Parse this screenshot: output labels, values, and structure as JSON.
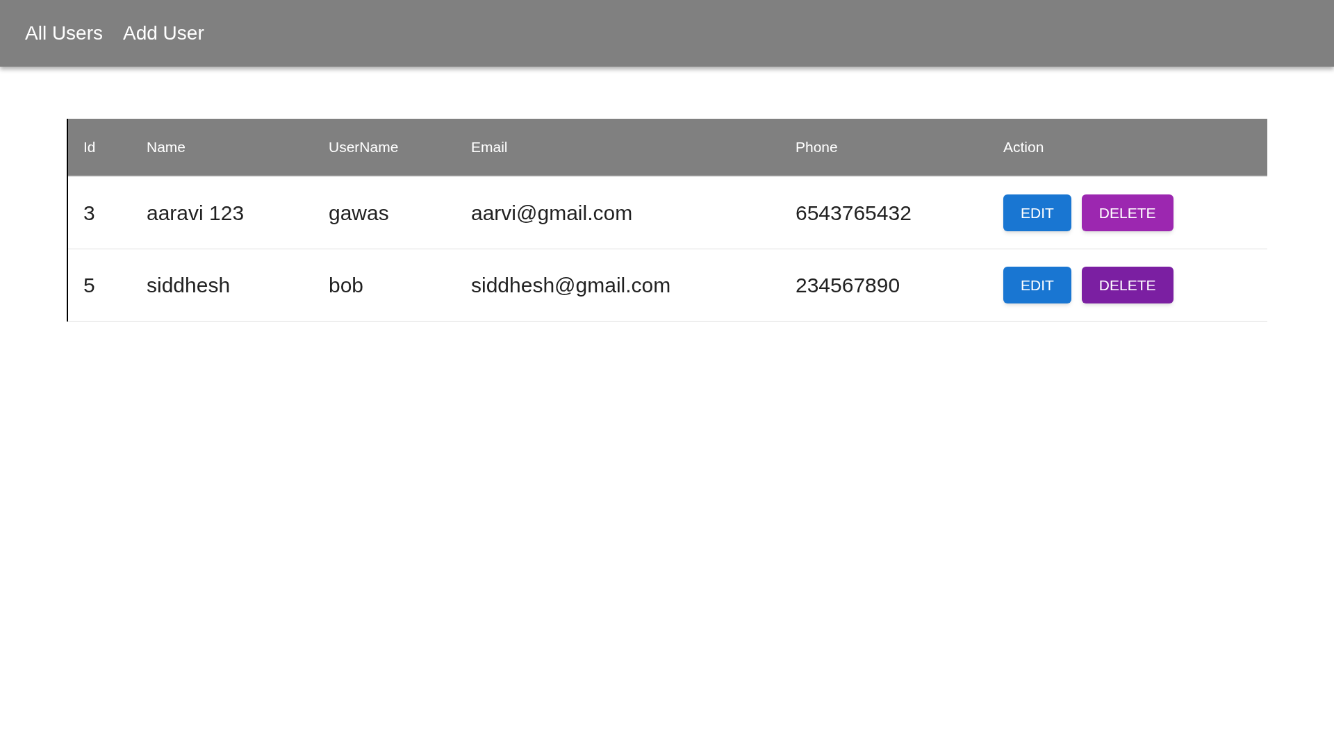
{
  "nav": {
    "links": [
      {
        "label": "All Users"
      },
      {
        "label": "Add User"
      }
    ]
  },
  "table": {
    "columns": [
      "Id",
      "Name",
      "UserName",
      "Email",
      "Phone",
      "Action"
    ],
    "rows": [
      {
        "id": "3",
        "name": "aaravi 123",
        "username": "gawas",
        "email": "aarvi@gmail.com",
        "phone": "6543765432",
        "actions": [
          {
            "label": "EDIT",
            "kind": "edit",
            "hovered": false
          },
          {
            "label": "DELETE",
            "kind": "delete",
            "hovered": false
          }
        ]
      },
      {
        "id": "5",
        "name": "siddhesh",
        "username": "bob",
        "email": "siddhesh@gmail.com",
        "phone": "234567890",
        "actions": [
          {
            "label": "EDIT",
            "kind": "edit",
            "hovered": false
          },
          {
            "label": "DELETE",
            "kind": "delete",
            "hovered": true
          }
        ]
      }
    ]
  }
}
